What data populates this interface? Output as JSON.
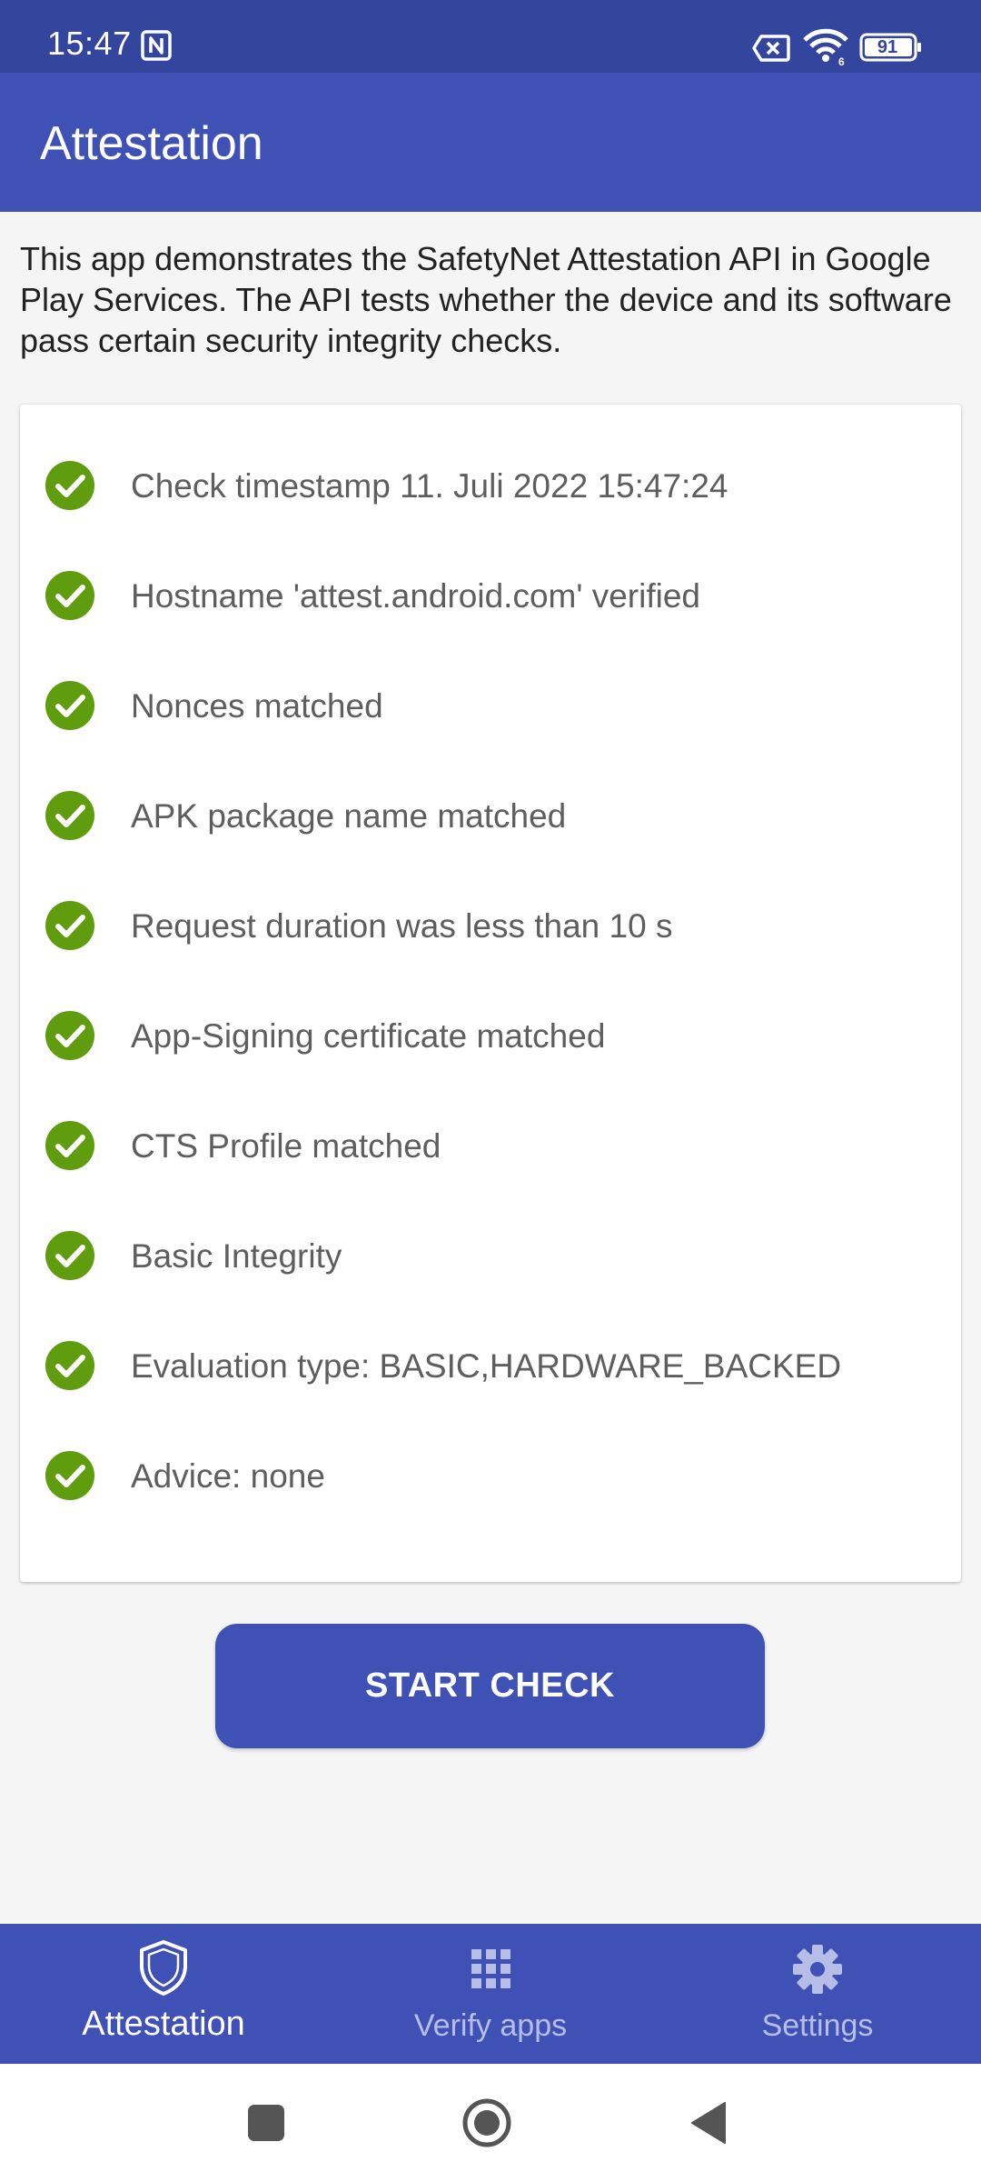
{
  "status_bar": {
    "time": "15:47",
    "battery": "91",
    "icons": [
      "nfc-icon",
      "sim-off-icon",
      "wifi-icon",
      "battery-icon"
    ]
  },
  "app_bar": {
    "title": "Attestation"
  },
  "description": "This app demonstrates the SafetyNet Attestation API in Google Play Services. The API tests whether the device and its software pass certain security integrity checks.",
  "checks": [
    {
      "label": "Check timestamp 11. Juli 2022 15:47:24",
      "status": "passed"
    },
    {
      "label": "Hostname 'attest.android.com' verified",
      "status": "passed"
    },
    {
      "label": "Nonces matched",
      "status": "passed"
    },
    {
      "label": "APK package name matched",
      "status": "passed"
    },
    {
      "label": "Request duration was less than 10 s",
      "status": "passed"
    },
    {
      "label": "App-Signing certificate matched",
      "status": "passed"
    },
    {
      "label": "CTS Profile matched",
      "status": "passed"
    },
    {
      "label": "Basic Integrity",
      "status": "passed"
    },
    {
      "label": "Evaluation type: BASIC,HARDWARE_BACKED",
      "status": "passed"
    },
    {
      "label": "Advice: none",
      "status": "passed"
    }
  ],
  "start_button": {
    "label": "START CHECK"
  },
  "bottom_nav": {
    "items": [
      {
        "label": "Attestation",
        "icon": "shield-icon",
        "active": true
      },
      {
        "label": "Verify apps",
        "icon": "apps-grid-icon",
        "active": false
      },
      {
        "label": "Settings",
        "icon": "gear-icon",
        "active": false
      }
    ]
  },
  "system_nav": {
    "icons": [
      "recents-icon",
      "home-icon",
      "back-icon"
    ]
  },
  "colors": {
    "status_bar": "#34459e",
    "primary": "#3f51b5",
    "check_green": "#5f9c0e",
    "background": "#f5f5f5"
  }
}
